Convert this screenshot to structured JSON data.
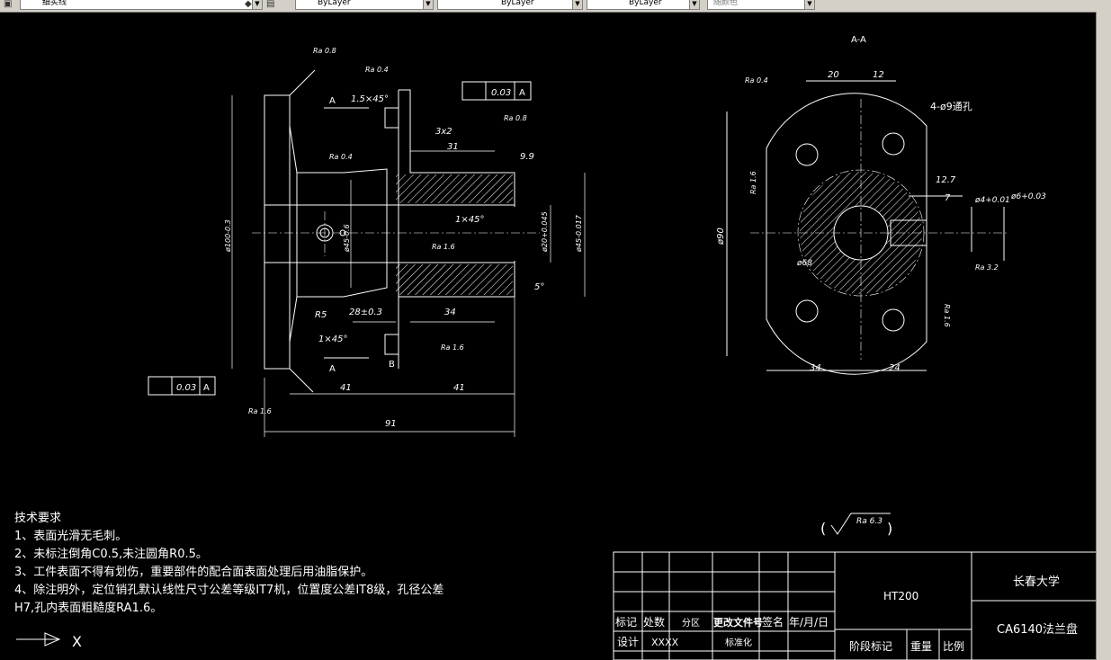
{
  "toolbar": {
    "layer_value": "细实线",
    "color_value": "ByLayer",
    "linetype_value": "ByLayer",
    "lineweight_value": "ByLayer",
    "plotstyle_value": "随颜色"
  },
  "section_title": "A-A",
  "dims": {
    "d91": "91",
    "d41a": "41",
    "d41b": "41",
    "d28": "28±0.3",
    "d34": "34",
    "d31": "31",
    "c15x45": "1.5×45°",
    "c3x2": "3x2",
    "c1x45a": "1×45°",
    "c1x45b": "1×45°",
    "r5": "R5",
    "d99": "9.9",
    "d5": "5°",
    "dia100": "ø100-0.3",
    "dia45": "ø45-0.6",
    "dia20": "ø20+0.045",
    "dia45b": "ø45-0.017",
    "d20": "20",
    "d12": "12",
    "d127": "12.7",
    "d7": "7",
    "dia90": "ø90",
    "dia68": "ø68",
    "dia4": "ø4+0.01",
    "dia6": "ø6+0.03",
    "b34": "34",
    "b24": "24",
    "holes": "4-ø9通孔",
    "A1": "A",
    "A2": "A",
    "B": "B"
  },
  "roughness": {
    "r08a": "Ra 0.8",
    "r04a": "Ra 0.4",
    "r04b": "Ra 0.4",
    "r08b": "Ra 0.8",
    "r16a": "Ra 1.6",
    "r16b": "Ra 1.6",
    "r16c": "Ra 1.6",
    "r04c": "Ra 0.4",
    "r16d": "Ra 1.6",
    "r32": "Ra 3.2",
    "r16e": "Ra 1.6",
    "general": "Ra 6.3"
  },
  "tolerance_frames": [
    {
      "value": "0.03",
      "datum": "A"
    },
    {
      "value": "0.03",
      "datum": "A"
    }
  ],
  "tech_requirements": {
    "title": "技术要求",
    "line1": "1、表面光滑无毛刺。",
    "line2": "2、未标注倒角C0.5,未注圆角R0.5。",
    "line3": "3、工件表面不得有划伤，重要部件的配合面表面处理后用油脂保护。",
    "line4a": "4、除注明外，定位销孔默认线性尺寸公差等级IT7机，位置度公差IT8级，孔径公差",
    "line4b": "H7,孔内表面粗糙度RA1.6。"
  },
  "title_block": {
    "material": "HT200",
    "university": "长春大学",
    "part_name": "CA6140法兰盘",
    "h_mark": "标记",
    "h_count": "处数",
    "h_zone": "分区",
    "h_docno": "更改文件号",
    "h_sign": "签名",
    "h_date": "年/月/日",
    "r_design": "设计",
    "r_design_name": "XXXX",
    "r_standard": "标准化",
    "f_stage": "阶段标记",
    "f_weight": "重量",
    "f_scale": "比例"
  },
  "command_arrow": "→ X"
}
